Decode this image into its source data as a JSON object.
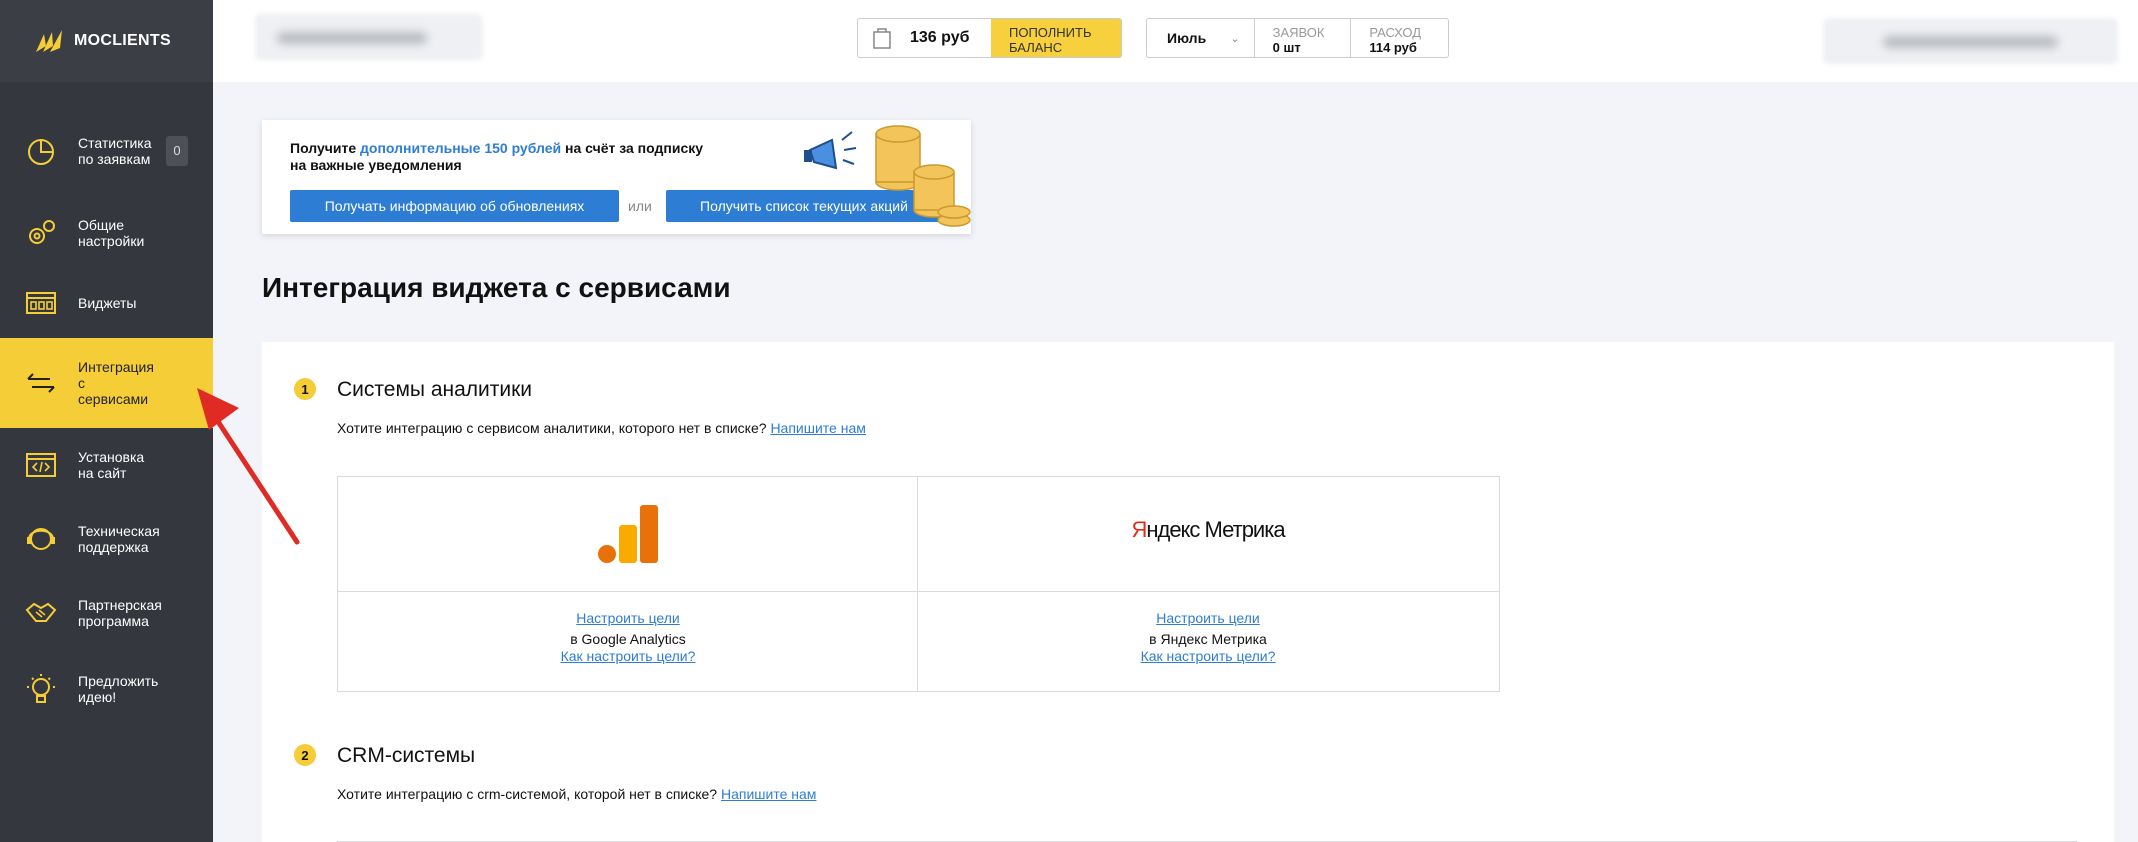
{
  "brand": {
    "name": "MOCLIENTS"
  },
  "sidebar": {
    "items": [
      {
        "label": "Статистика по заявкам",
        "icon": "pie-chart-icon",
        "badge": "0"
      },
      {
        "label": "Общие настройки",
        "icon": "gears-icon"
      },
      {
        "label": "Виджеты",
        "icon": "widget-icon"
      },
      {
        "label": "Интеграция с сервисами",
        "icon": "arrows-exchange-icon",
        "active": true
      },
      {
        "label": "Установка на сайт",
        "icon": "code-icon"
      },
      {
        "label": "Техническая поддержка",
        "icon": "support-icon"
      },
      {
        "label": "Партнерская программа",
        "icon": "handshake-icon"
      },
      {
        "label": "Предложить идею!",
        "icon": "lightbulb-icon"
      }
    ]
  },
  "header": {
    "balance": "136 руб",
    "topup_label": "ПОПОЛНИТЬ БАЛАНС",
    "month": "Июль",
    "leads_label": "ЗАЯВОК",
    "leads_value": "0 шт",
    "expense_label": "РАСХОД",
    "expense_value": "114 руб"
  },
  "promo": {
    "text_pre": "Получите ",
    "text_highlight": "дополнительные 150 рублей",
    "text_post": " на счёт за подписку",
    "text_line2": "на важные уведомления",
    "btn_updates": "Получать информацию об обновлениях",
    "or": "или",
    "btn_promos": "Получить список текущих акций"
  },
  "page_title": "Интеграция виджета с сервисами",
  "sections": {
    "analytics": {
      "num": "1",
      "title": "Системы аналитики",
      "question": "Хотите интеграцию с сервисом аналитики, которого нет в списке?",
      "link": "Напишите нам",
      "services": [
        {
          "setup_link": "Настроить цели",
          "name": "в Google Analytics",
          "howto": "Как настроить цели?"
        },
        {
          "logo_red": "Я",
          "logo_rest": "ндекс Метрика",
          "setup_link": "Настроить цели",
          "name": "в Яндекс Метрика",
          "howto": "Как настроить цели?"
        }
      ]
    },
    "crm": {
      "num": "2",
      "title": "CRM-системы",
      "question": "Хотите интеграцию с crm-системой, которой нет в списке?",
      "link": "Напишите нам"
    }
  },
  "colors": {
    "accent": "#f5cd36",
    "link": "#2d7dd4",
    "sidebar": "#34373d"
  }
}
